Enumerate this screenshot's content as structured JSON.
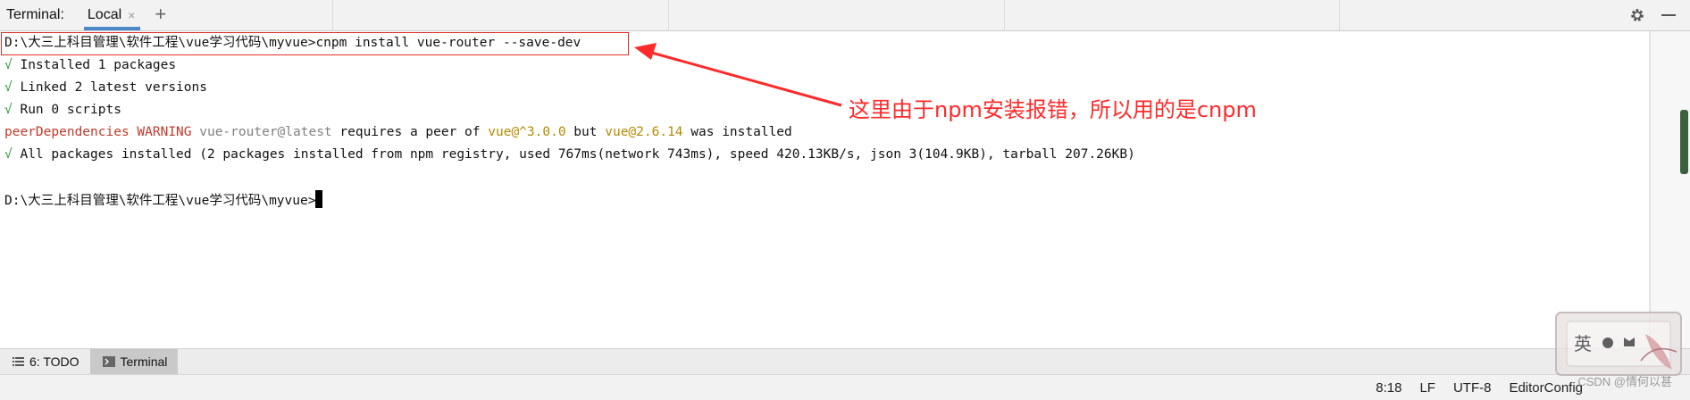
{
  "topbar": {
    "title": "Terminal:",
    "tab_label": "Local",
    "close_glyph": "×",
    "add_glyph": "+"
  },
  "terminal": {
    "command_line": "D:\\大三上科目管理\\软件工程\\vue学习代码\\myvue>cnpm install vue-router --save-dev",
    "line1": {
      "check": "√",
      "text": " Installed 1 packages"
    },
    "line2": {
      "check": "√",
      "text": " Linked 2 latest versions"
    },
    "line3": {
      "check": "√",
      "text": " Run 0 scripts"
    },
    "warning": {
      "part1": "peerDependencies WARNING",
      "part2": " vue-router@latest",
      "part3": " requires a peer of ",
      "part4": "vue@^3.0.0",
      "part5": " but ",
      "part6": "vue@2.6.14",
      "part7": " was installed"
    },
    "line5": {
      "check": "√",
      "text": " All packages installed (2 packages installed from npm registry, used 767ms(network 743ms), speed 420.13KB/s, json 3(104.9KB), tarball 207.26KB)"
    },
    "prompt": "D:\\大三上科目管理\\软件工程\\vue学习代码\\myvue>"
  },
  "annotation": {
    "text": "这里由于npm安装报错，所以用的是cnpm",
    "color": "#ff2a2a"
  },
  "tool_windows": {
    "todo_label": "6: TODO",
    "terminal_label": "Terminal"
  },
  "status": {
    "position": "8:18",
    "line_sep": "LF",
    "encoding": "UTF-8",
    "editorconfig": "EditorConfig"
  },
  "watermark": {
    "text": "CSDN @情何以甚"
  },
  "icons": [
    "close-icon",
    "add-tab-icon",
    "gear-icon",
    "minimize-icon",
    "todo-list-icon",
    "terminal-icon"
  ]
}
